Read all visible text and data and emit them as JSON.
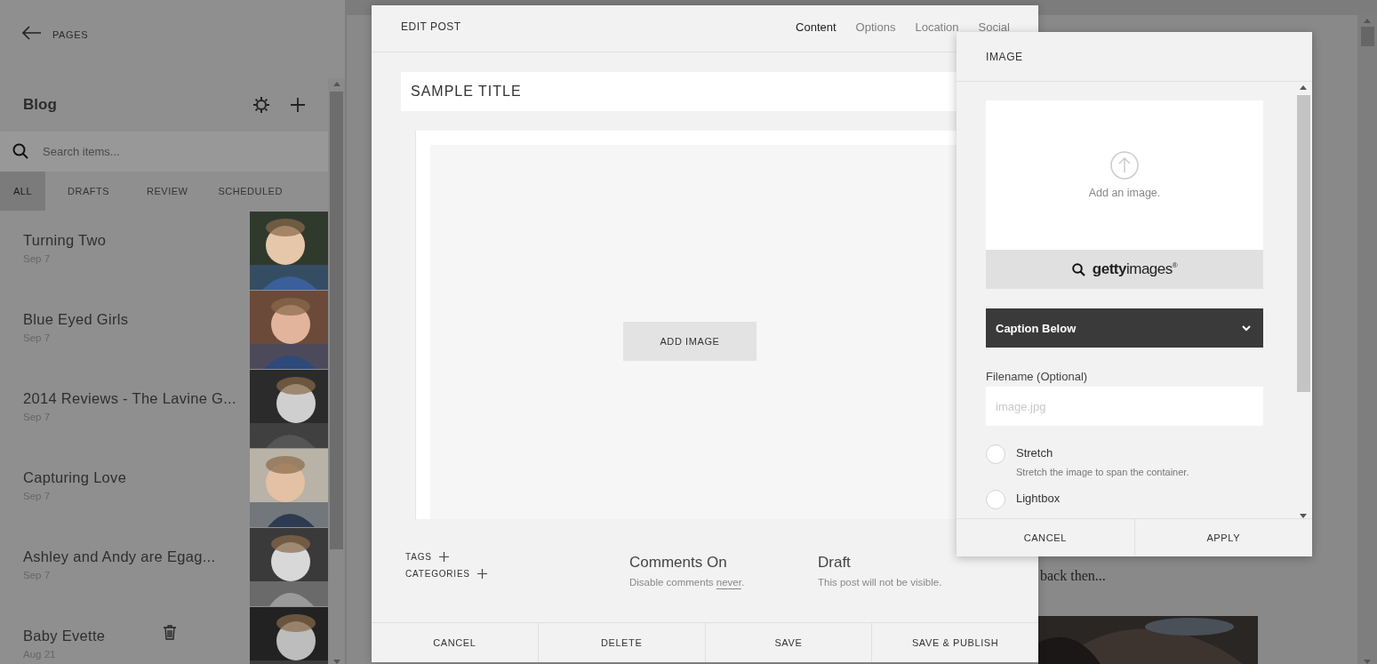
{
  "sidebar": {
    "back_label": "PAGES",
    "title": "Blog",
    "search": {
      "placeholder": "Search items..."
    },
    "filters": [
      {
        "label": "ALL",
        "selected": true
      },
      {
        "label": "DRAFTS",
        "selected": false
      },
      {
        "label": "REVIEW",
        "selected": false
      },
      {
        "label": "SCHEDULED",
        "selected": false
      }
    ],
    "posts": [
      {
        "title": "Turning Two",
        "date": "Sep 7"
      },
      {
        "title": "Blue Eyed Girls",
        "date": "Sep 7"
      },
      {
        "title": "2014 Reviews - The Lavine G...",
        "date": "Sep 7"
      },
      {
        "title": "Capturing Love",
        "date": "Sep 7"
      },
      {
        "title": "Ashley and Andy are Egag...",
        "date": "Sep 7"
      },
      {
        "title": "Baby Evette",
        "date": "Aug 21"
      }
    ]
  },
  "background_page": {
    "text": "back then..."
  },
  "edit_post": {
    "title": "EDIT POST",
    "tabs": [
      {
        "label": "Content",
        "selected": true
      },
      {
        "label": "Options",
        "selected": false
      },
      {
        "label": "Location",
        "selected": false
      },
      {
        "label": "Social",
        "selected": false
      }
    ],
    "title_field": {
      "value": "SAMPLE TITLE"
    },
    "add_image": "ADD IMAGE",
    "tags_label": "TAGS",
    "categories_label": "CATEGORIES",
    "comments": {
      "heading": "Comments On",
      "text": "Disable comments",
      "link": "never",
      "after": "."
    },
    "status": {
      "heading": "Draft",
      "text": "This post will not be visible."
    },
    "buttons": [
      "CANCEL",
      "DELETE",
      "SAVE",
      "SAVE & PUBLISH"
    ]
  },
  "image_panel": {
    "title": "IMAGE",
    "upload_hint": "Add an image.",
    "stock_search": "**getty**images$^{®}$",
    "caption_select": {
      "value": "Caption Below"
    },
    "filename": {
      "label": "Filename (Optional)",
      "placeholder": "image.jpg"
    },
    "options": [
      {
        "label": "Stretch",
        "description": "Stretch the image to span the container.",
        "selected": false
      },
      {
        "label": "Lightbox",
        "selected": false
      }
    ],
    "buttons": [
      "CANCEL",
      "APPLY"
    ]
  }
}
